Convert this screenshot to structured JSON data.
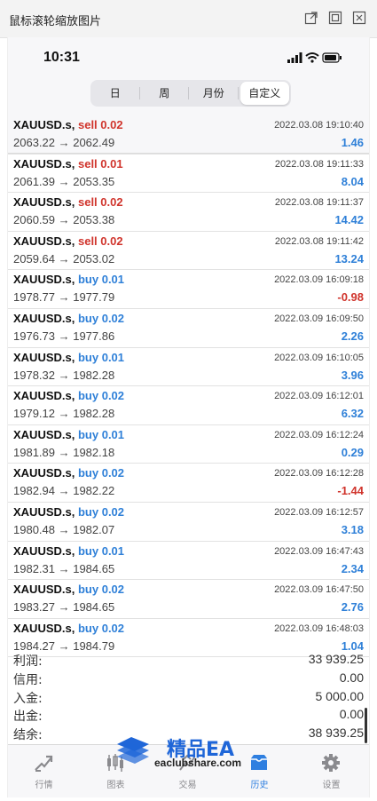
{
  "window": {
    "title": "鼠标滚轮缩放图片",
    "controls": [
      "popout-icon",
      "maximize-icon",
      "close-icon"
    ]
  },
  "status_bar": {
    "time": "10:31"
  },
  "segment": {
    "tabs": [
      {
        "label": "日",
        "active": false
      },
      {
        "label": "周",
        "active": false
      },
      {
        "label": "月份",
        "active": false
      },
      {
        "label": "自定义",
        "active": true
      }
    ]
  },
  "trades": [
    {
      "symbol": "XAUUSD.s,",
      "side": "sell",
      "volume": "0.02",
      "side_text": "sell 0.02",
      "prices": "2063.22 → 2062.49",
      "datetime": "2022.03.08 19:10:40",
      "profit": "1.46"
    },
    {
      "symbol": "XAUUSD.s,",
      "side": "sell",
      "volume": "0.01",
      "side_text": "sell 0.01",
      "prices": "2061.39 → 2053.35",
      "datetime": "2022.03.08 19:11:33",
      "profit": "8.04"
    },
    {
      "symbol": "XAUUSD.s,",
      "side": "sell",
      "volume": "0.02",
      "side_text": "sell 0.02",
      "prices": "2060.59 → 2053.38",
      "datetime": "2022.03.08 19:11:37",
      "profit": "14.42"
    },
    {
      "symbol": "XAUUSD.s,",
      "side": "sell",
      "volume": "0.02",
      "side_text": "sell 0.02",
      "prices": "2059.64 → 2053.02",
      "datetime": "2022.03.08 19:11:42",
      "profit": "13.24"
    },
    {
      "symbol": "XAUUSD.s,",
      "side": "buy",
      "volume": "0.01",
      "side_text": "buy 0.01",
      "prices": "1978.77 → 1977.79",
      "datetime": "2022.03.09 16:09:18",
      "profit": "-0.98"
    },
    {
      "symbol": "XAUUSD.s,",
      "side": "buy",
      "volume": "0.02",
      "side_text": "buy 0.02",
      "prices": "1976.73 → 1977.86",
      "datetime": "2022.03.09 16:09:50",
      "profit": "2.26"
    },
    {
      "symbol": "XAUUSD.s,",
      "side": "buy",
      "volume": "0.01",
      "side_text": "buy 0.01",
      "prices": "1978.32 → 1982.28",
      "datetime": "2022.03.09 16:10:05",
      "profit": "3.96"
    },
    {
      "symbol": "XAUUSD.s,",
      "side": "buy",
      "volume": "0.02",
      "side_text": "buy 0.02",
      "prices": "1979.12 → 1982.28",
      "datetime": "2022.03.09 16:12:01",
      "profit": "6.32"
    },
    {
      "symbol": "XAUUSD.s,",
      "side": "buy",
      "volume": "0.01",
      "side_text": "buy 0.01",
      "prices": "1981.89 → 1982.18",
      "datetime": "2022.03.09 16:12:24",
      "profit": "0.29"
    },
    {
      "symbol": "XAUUSD.s,",
      "side": "buy",
      "volume": "0.02",
      "side_text": "buy 0.02",
      "prices": "1982.94 → 1982.22",
      "datetime": "2022.03.09 16:12:28",
      "profit": "-1.44"
    },
    {
      "symbol": "XAUUSD.s,",
      "side": "buy",
      "volume": "0.02",
      "side_text": "buy 0.02",
      "prices": "1980.48 → 1982.07",
      "datetime": "2022.03.09 16:12:57",
      "profit": "3.18"
    },
    {
      "symbol": "XAUUSD.s,",
      "side": "buy",
      "volume": "0.01",
      "side_text": "buy 0.01",
      "prices": "1982.31 → 1984.65",
      "datetime": "2022.03.09 16:47:43",
      "profit": "2.34"
    },
    {
      "symbol": "XAUUSD.s,",
      "side": "buy",
      "volume": "0.02",
      "side_text": "buy 0.02",
      "prices": "1983.27 → 1984.65",
      "datetime": "2022.03.09 16:47:50",
      "profit": "2.76"
    },
    {
      "symbol": "XAUUSD.s,",
      "side": "buy",
      "volume": "0.02",
      "side_text": "buy 0.02",
      "prices": "1984.27 → 1984.79",
      "datetime": "2022.03.09 16:48:03",
      "profit": "1.04"
    }
  ],
  "summary": [
    {
      "label": "利润:",
      "value": "33 939.25"
    },
    {
      "label": "信用:",
      "value": "0.00"
    },
    {
      "label": "入金:",
      "value": "5 000.00"
    },
    {
      "label": "出金:",
      "value": "0.00"
    },
    {
      "label": "结余:",
      "value": "38 939.25"
    }
  ],
  "tab_bar": [
    {
      "label": "行情",
      "icon": "quotes-icon",
      "active": false
    },
    {
      "label": "图表",
      "icon": "chart-icon",
      "active": false
    },
    {
      "label": "交易",
      "icon": "trade-icon",
      "active": false
    },
    {
      "label": "历史",
      "icon": "history-icon",
      "active": true
    },
    {
      "label": "设置",
      "icon": "gear-icon",
      "active": false
    }
  ],
  "watermark": {
    "brand": "精品EA",
    "site": "eaclubshare.com"
  },
  "colors": {
    "sell": "#d0342c",
    "buy": "#2f80d8",
    "active_tab": "#2f7fe0",
    "negative": "#d0342c",
    "positive": "#2f80d8"
  }
}
